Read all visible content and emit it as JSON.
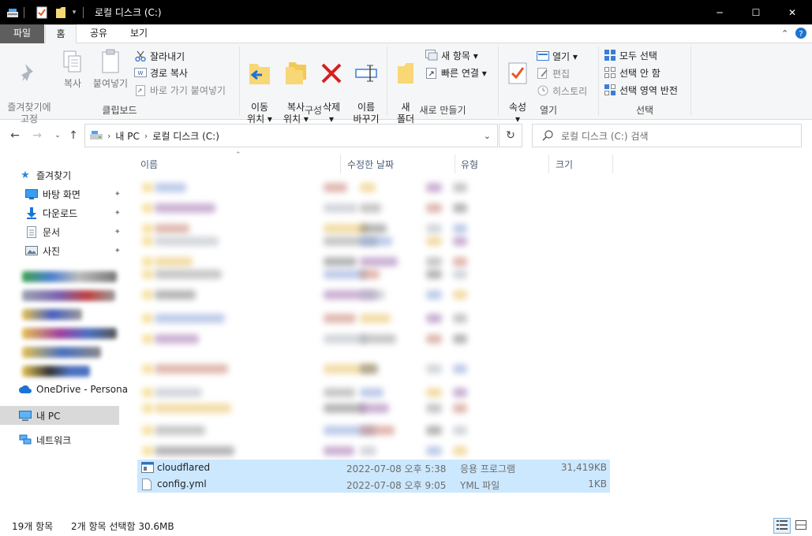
{
  "window": {
    "title": "로컬 디스크 (C:)",
    "controls": {
      "minimize": "─",
      "maximize": "☐",
      "close": "✕"
    }
  },
  "ribbon_tabs": {
    "file": "파일",
    "home": "홈",
    "share": "공유",
    "view": "보기"
  },
  "ribbon": {
    "clipboard": {
      "label": "클립보드",
      "pin": "즐겨찾기에\n고정",
      "copy": "복사",
      "paste": "붙여넣기",
      "cut": "잘라내기",
      "copy_path": "경로 복사",
      "paste_shortcut": "바로 가기 붙여넣기"
    },
    "organize": {
      "label": "구성",
      "move_to": "이동\n위치 ▾",
      "copy_to": "복사\n위치 ▾",
      "delete": "삭제\n▾",
      "rename": "이름\n바꾸기"
    },
    "new": {
      "label": "새로 만들기",
      "new_folder": "새\n폴더",
      "new_item": "새 항목 ▾",
      "easy_access": "빠른 연결 ▾"
    },
    "open": {
      "label": "열기",
      "properties": "속성\n▾",
      "open": "열기 ▾",
      "edit": "편집",
      "history": "히스토리"
    },
    "select": {
      "label": "선택",
      "select_all": "모두 선택",
      "select_none": "선택 안 함",
      "invert": "선택 영역 반전"
    }
  },
  "address": {
    "crumbs": [
      "내 PC",
      "로컬 디스크 (C:)"
    ],
    "search_placeholder": "로컬 디스크 (C:) 검색"
  },
  "nav": {
    "quick_access": "즐겨찾기",
    "desktop": "바탕 화면",
    "downloads": "다운로드",
    "documents": "문서",
    "pictures": "사진",
    "onedrive": "OneDrive - Persona",
    "this_pc": "내 PC",
    "network": "네트워크"
  },
  "columns": {
    "name": "이름",
    "modified": "수정한 날짜",
    "type": "유형",
    "size": "크기"
  },
  "files": [
    {
      "name": "cloudflared",
      "modified": "2022-07-08 오후 5:38",
      "type": "응용 프로그램",
      "size": "31,419KB"
    },
    {
      "name": "config.yml",
      "modified": "2022-07-08 오후 9:05",
      "type": "YML 파일",
      "size": "1KB"
    }
  ],
  "status": {
    "count": "19개 항목",
    "selected": "2개 항목 선택함 30.6MB"
  },
  "colors": {
    "selection": "#cce8ff",
    "accent": "#0078d7",
    "file_tab": "#5e5e5e"
  }
}
